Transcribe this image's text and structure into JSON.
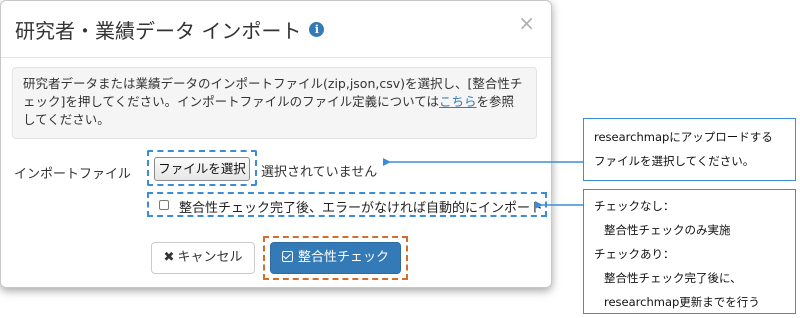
{
  "modal": {
    "title": "研究者・業績データ インポート",
    "close_label": "×",
    "description_before_link": "研究者データまたは業績データのインポートファイル(zip,json,csv)を選択し、[整合性チェック]を押してください。インポートファイルのファイル定義については",
    "description_link": "こちら",
    "description_after_link": "を参照してください。",
    "file_label": "インポートファイル",
    "file_button_label": "ファイルを選択",
    "file_status": "選択されていません",
    "checkbox_label": "整合性チェック完了後、エラーがなければ自動的にインポート",
    "checkbox_checked": false,
    "cancel_label": "キャンセル",
    "submit_label": "整合性チェック"
  },
  "callouts": {
    "file": {
      "line1": "researchmapにアップロードする",
      "line2": "ファイルを選択してください。"
    },
    "checkbox": {
      "line1": "チェックなし：",
      "line2": "整合性チェックのみ実施",
      "line3": "チェックあり：",
      "line4": "整合性チェック完了後に、",
      "line5": "researchmap更新までを行う"
    }
  },
  "colors": {
    "primary": "#337ab7",
    "callout_border": "#3c8dd8",
    "highlight_orange": "#d26d2a"
  }
}
